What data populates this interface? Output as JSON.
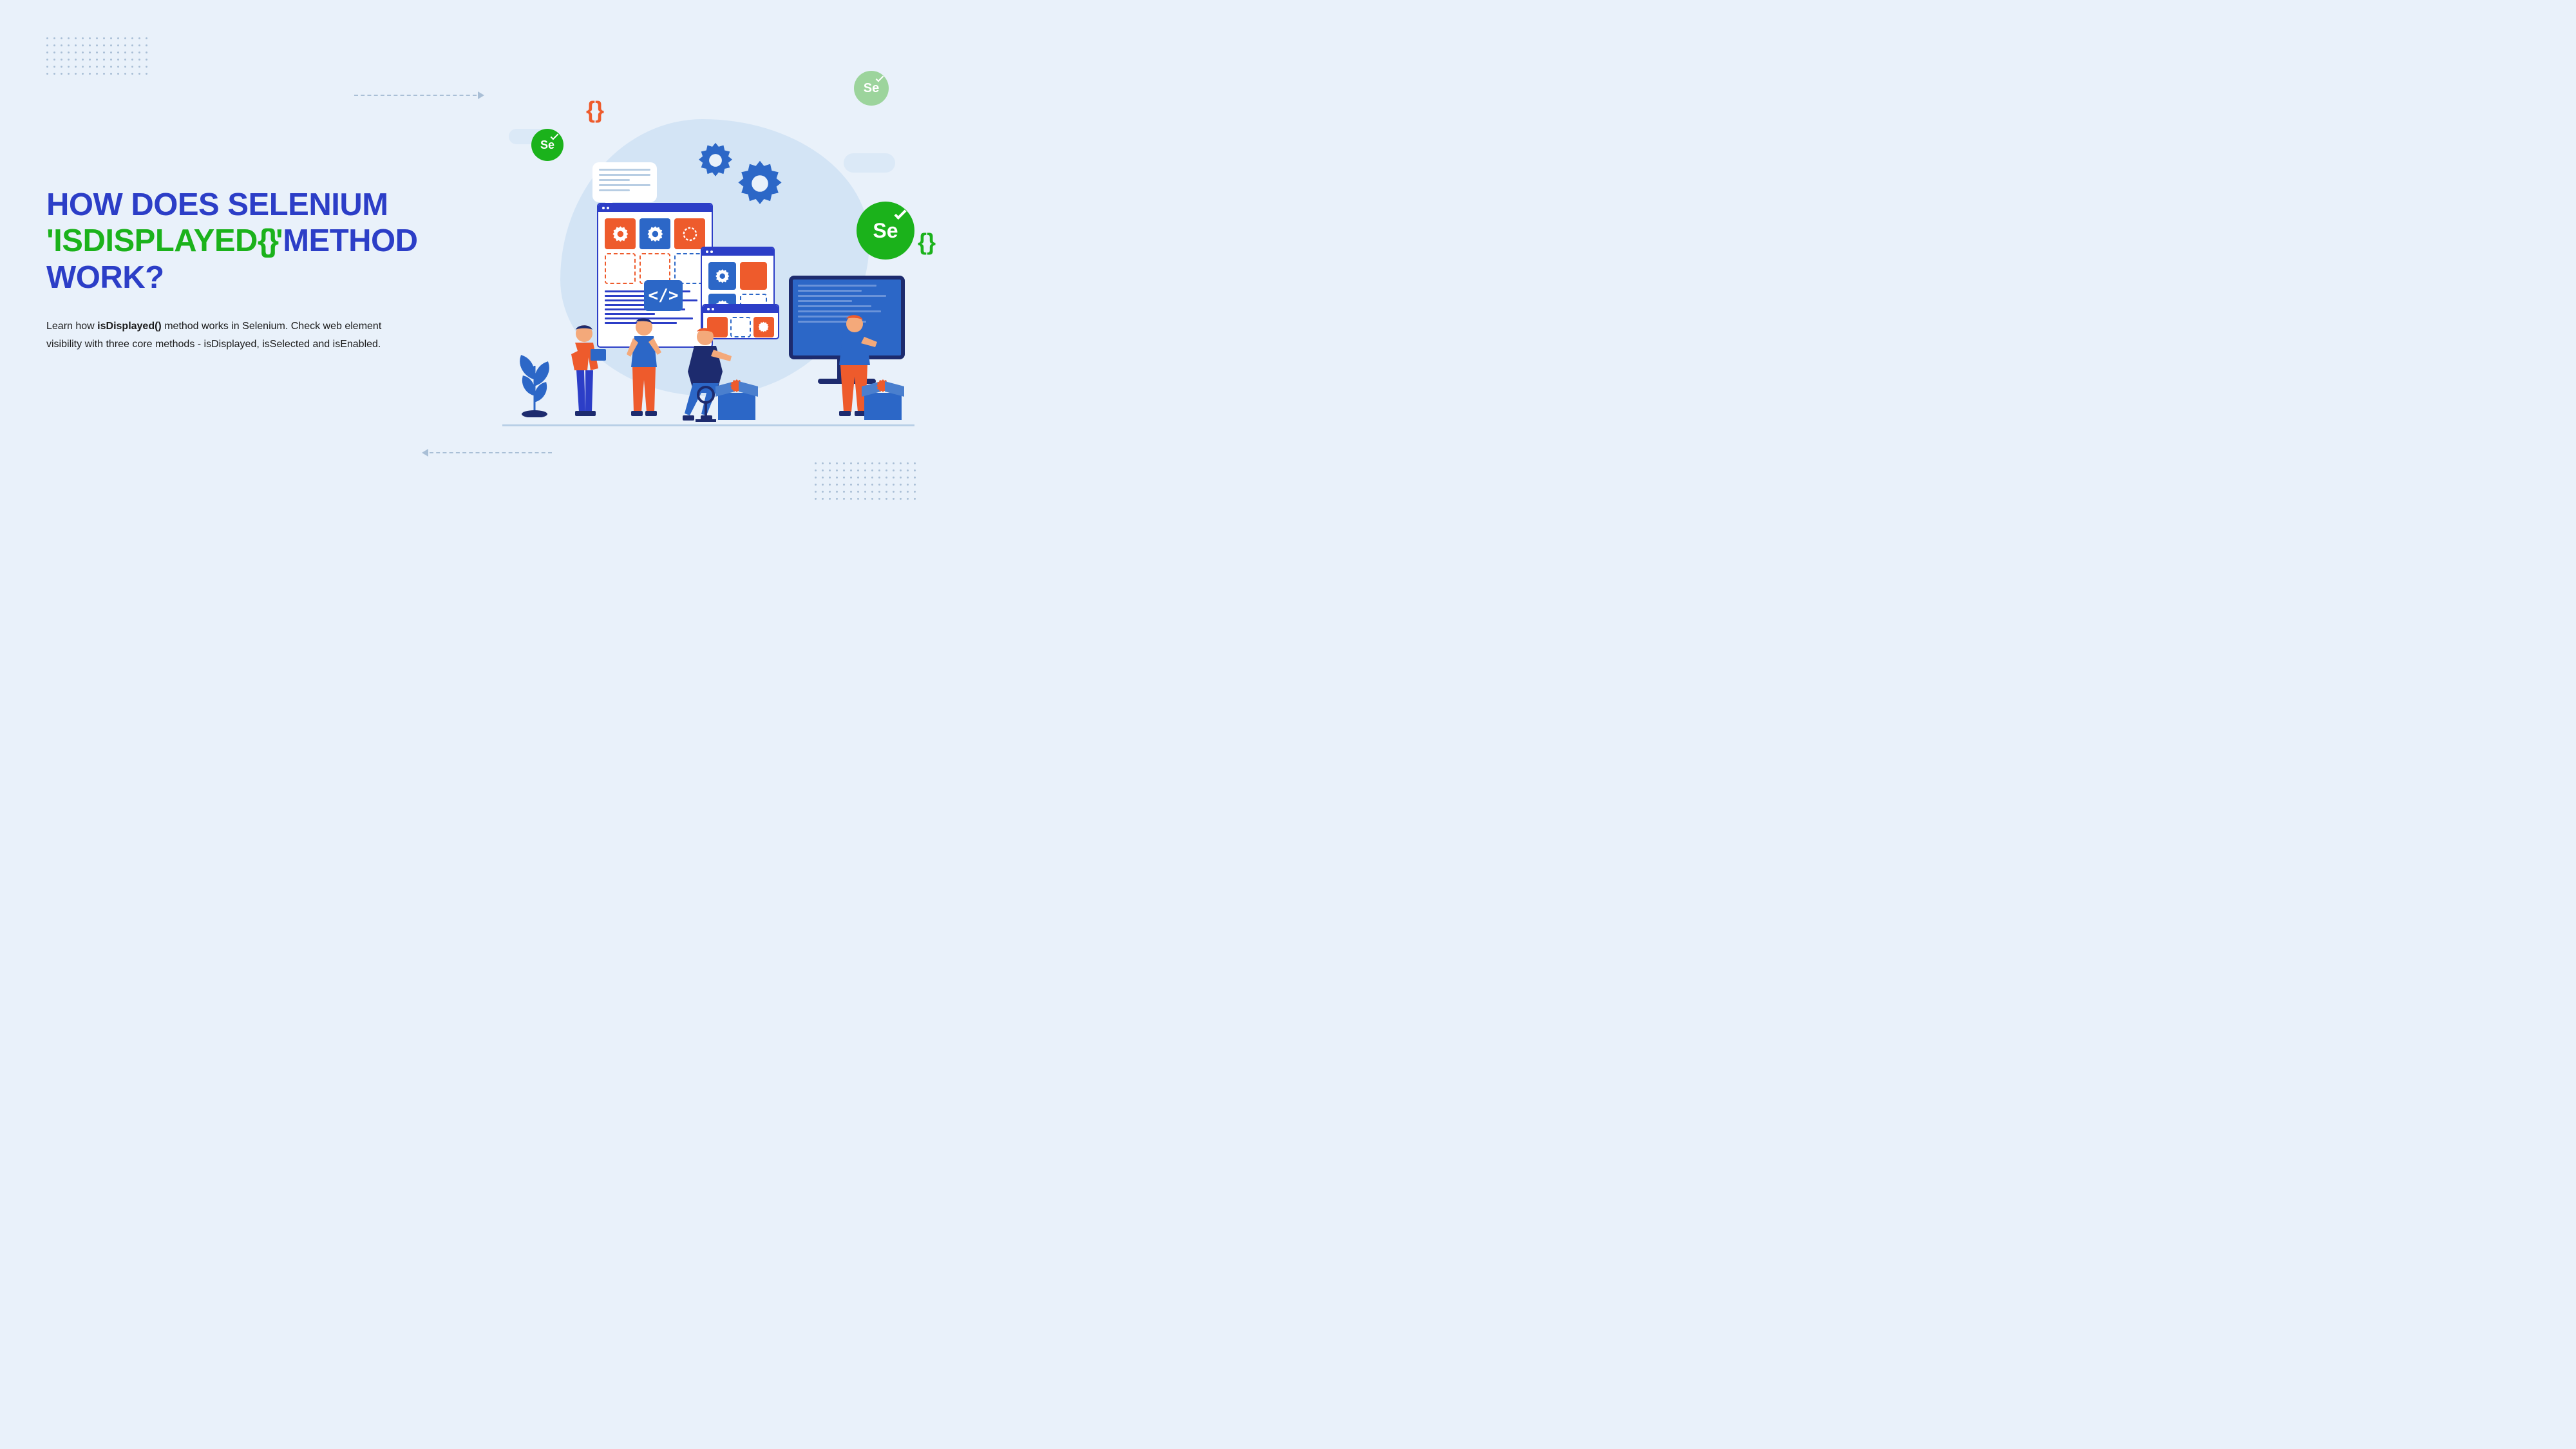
{
  "title": {
    "line1_a": "HOW DOES SELENIUM",
    "line2_quote_open": "'",
    "line2_green": "isDISPLAYED",
    "line2_braces": "{}",
    "line2_quote_close": "'",
    "line2_b": "METHOD",
    "line3": "WORK?"
  },
  "subtitle": {
    "t1": "Learn how ",
    "bold": "isDisplayed()",
    "t2": " method works in Selenium. Check web element visibility with three core methods - isDisplayed, isSelected and isEnabled."
  },
  "badges": {
    "se": "Se"
  },
  "code_badge": "</>",
  "colors": {
    "bg": "#e9f1fa",
    "blue": "#2c3ec7",
    "green": "#1bb21b",
    "orange": "#ee5b2c",
    "midblue": "#2c67c7"
  }
}
